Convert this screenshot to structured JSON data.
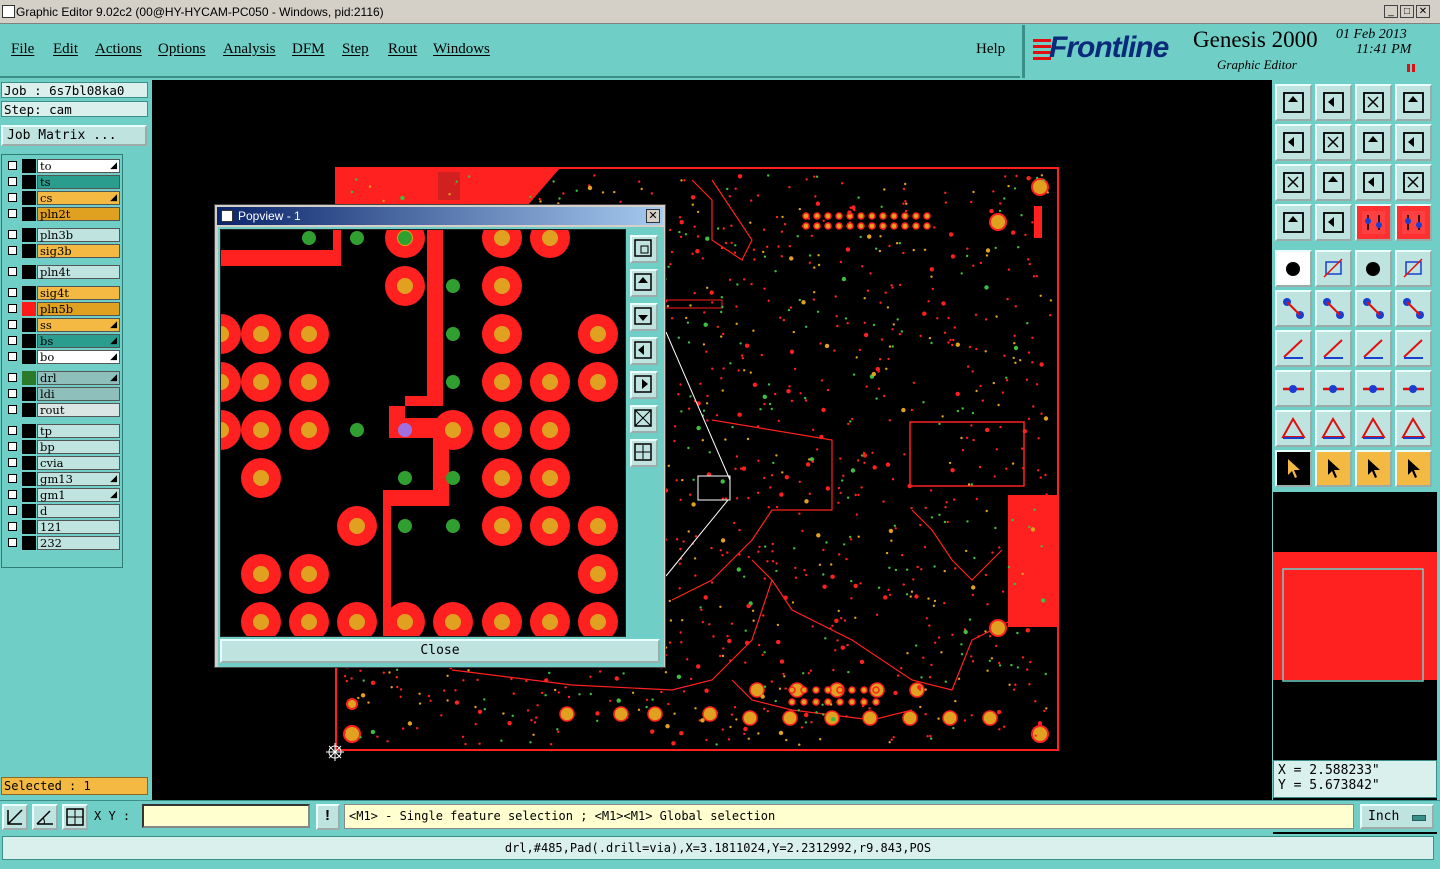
{
  "window": {
    "title": "Graphic Editor 9.02c2 (00@HY-HYCAM-PC050 - Windows, pid:2116)",
    "minimize": "_",
    "maximize": "□",
    "close": "✕"
  },
  "menu": [
    "File",
    "Edit",
    "Actions",
    "Options",
    "Analysis",
    "DFM",
    "Step",
    "Rout",
    "Windows"
  ],
  "help": "Help",
  "logo": {
    "brand": "Frontline",
    "product": "Genesis 2000",
    "subtitle": "Graphic Editor",
    "date": "01 Feb 2013",
    "time": "11:41 PM"
  },
  "job": {
    "job_label": "Job : 6s7bl08ka0",
    "step_label": "Step: cam",
    "matrix_button": "Job Matrix ..."
  },
  "layers": [
    {
      "name": "to",
      "color": "#ffffff",
      "box": "#000000",
      "mark": true
    },
    {
      "name": "ts",
      "color": "#2a9d8f",
      "box": "#000000",
      "mark": false
    },
    {
      "name": "cs",
      "color": "#f4b942",
      "box": "#000000",
      "mark": true
    },
    {
      "name": "pln2t",
      "color": "#e0a020",
      "box": "#000000",
      "mark": false
    },
    {
      "name": "pln3b",
      "color": "#bfe3df",
      "box": "#000000",
      "mark": false
    },
    {
      "name": "sig3b",
      "color": "#f4b942",
      "box": "#000000",
      "mark": false
    },
    {
      "name": "pln4t",
      "color": "#bfe3df",
      "box": "#000000",
      "mark": false
    },
    {
      "name": "sig4t",
      "color": "#f4b942",
      "box": "#000000",
      "mark": false
    },
    {
      "name": "pln5b",
      "color": "#e0a020",
      "box": "#ff1a1a",
      "mark": false
    },
    {
      "name": "ss",
      "color": "#f4b942",
      "box": "#000000",
      "mark": true
    },
    {
      "name": "bs",
      "color": "#2a9d8f",
      "box": "#000000",
      "mark": true
    },
    {
      "name": "bo",
      "color": "#ffffff",
      "box": "#000000",
      "mark": true
    },
    {
      "name": "drl",
      "color": "#8fbfbb",
      "box": "#2a7a2a",
      "mark": true
    },
    {
      "name": "ldi",
      "color": "#8fbfbb",
      "box": "#000000",
      "mark": false
    },
    {
      "name": "rout",
      "color": "#d9e6e4",
      "box": "#000000",
      "mark": false
    },
    {
      "name": "tp",
      "color": "#bfe3df",
      "box": "#000000",
      "mark": false
    },
    {
      "name": "bp",
      "color": "#bfe3df",
      "box": "#000000",
      "mark": false
    },
    {
      "name": "cvia",
      "color": "#bfe3df",
      "box": "#000000",
      "mark": false
    },
    {
      "name": "gm13",
      "color": "#bfe3df",
      "box": "#000000",
      "mark": true
    },
    {
      "name": "gm1",
      "color": "#bfe3df",
      "box": "#000000",
      "mark": true
    },
    {
      "name": "d",
      "color": "#bfe3df",
      "box": "#000000",
      "mark": false
    },
    {
      "name": "121",
      "color": "#bfe3df",
      "box": "#000000",
      "mark": false
    },
    {
      "name": "232",
      "color": "#bfe3df",
      "box": "#000000",
      "mark": false
    }
  ],
  "selected": "Selected : 1",
  "popview": {
    "title": "Popview - 1",
    "close_button": "Close",
    "close_x": "✕"
  },
  "coords": {
    "x": "X = 2.588233\"",
    "y": "Y = 5.673842\""
  },
  "cmdbar": {
    "xy_label": "X Y :",
    "xy_value": "",
    "alert": "!",
    "message": "<M1> - Single feature selection ; <M1><M1> Global selection",
    "unit": "Inch"
  },
  "status": "drl,#485,Pad(.drill=via),X=3.1811024,Y=2.2312992,r9.843,POS",
  "toolbar": {
    "row_icons": [
      "home-icon",
      "zoom-in-icon",
      "zoom-out-icon",
      "grid-icon",
      "pan-left-icon",
      "pan-right-icon",
      "mirror-icon",
      "route-icon",
      "fit-icon",
      "center-icon",
      "scale-icon",
      "help-icon",
      "measure-icon",
      "snap-icon",
      "layers-icon",
      "layers-alt-icon"
    ],
    "edit_icons": [
      "pad-icon",
      "rect-icon",
      "ruler-icon",
      "dot-icon",
      "connect-icon",
      "cross-icon",
      "move-icon",
      "drag-icon",
      "line-icon",
      "arc-icon",
      "rotate-icon",
      "split-icon",
      "copy-icon",
      "cut-icon",
      "align-icon",
      "cluster-icon",
      "triangle-icon",
      "arrow-triangle-icon",
      "arch-icon",
      "bridge-icon",
      "select-pointer-icon",
      "select-pointer-alt-icon",
      "select-circle-icon",
      "select-net-icon"
    ]
  }
}
